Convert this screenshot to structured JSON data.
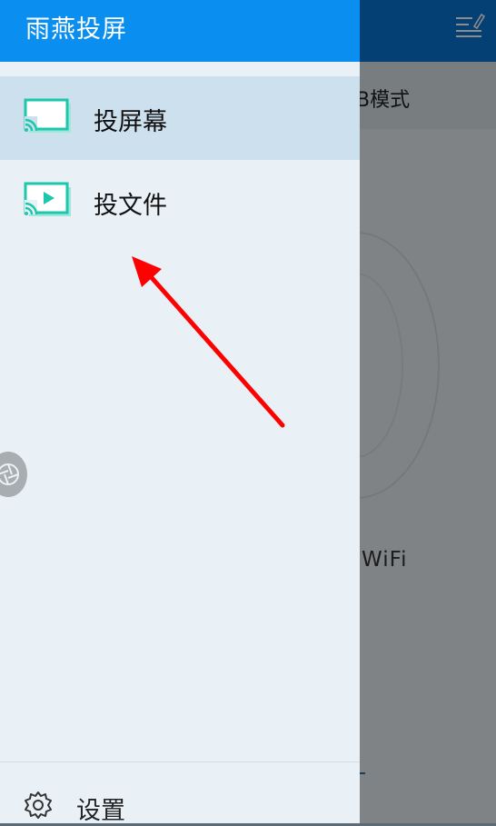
{
  "drawer": {
    "title": "雨燕投屏",
    "items": [
      {
        "label": "投屏幕",
        "icon": "cast-screen-icon",
        "active": true
      },
      {
        "label": "投文件",
        "icon": "cast-file-icon",
        "active": false
      }
    ],
    "settings_label": "设置"
  },
  "background": {
    "mode_text": "B模式",
    "wifi_text": "WiFi"
  },
  "colors": {
    "drawer_header": "#0a8ff1",
    "accent_teal": "#2dcfb6",
    "arrow": "#ff0000"
  }
}
